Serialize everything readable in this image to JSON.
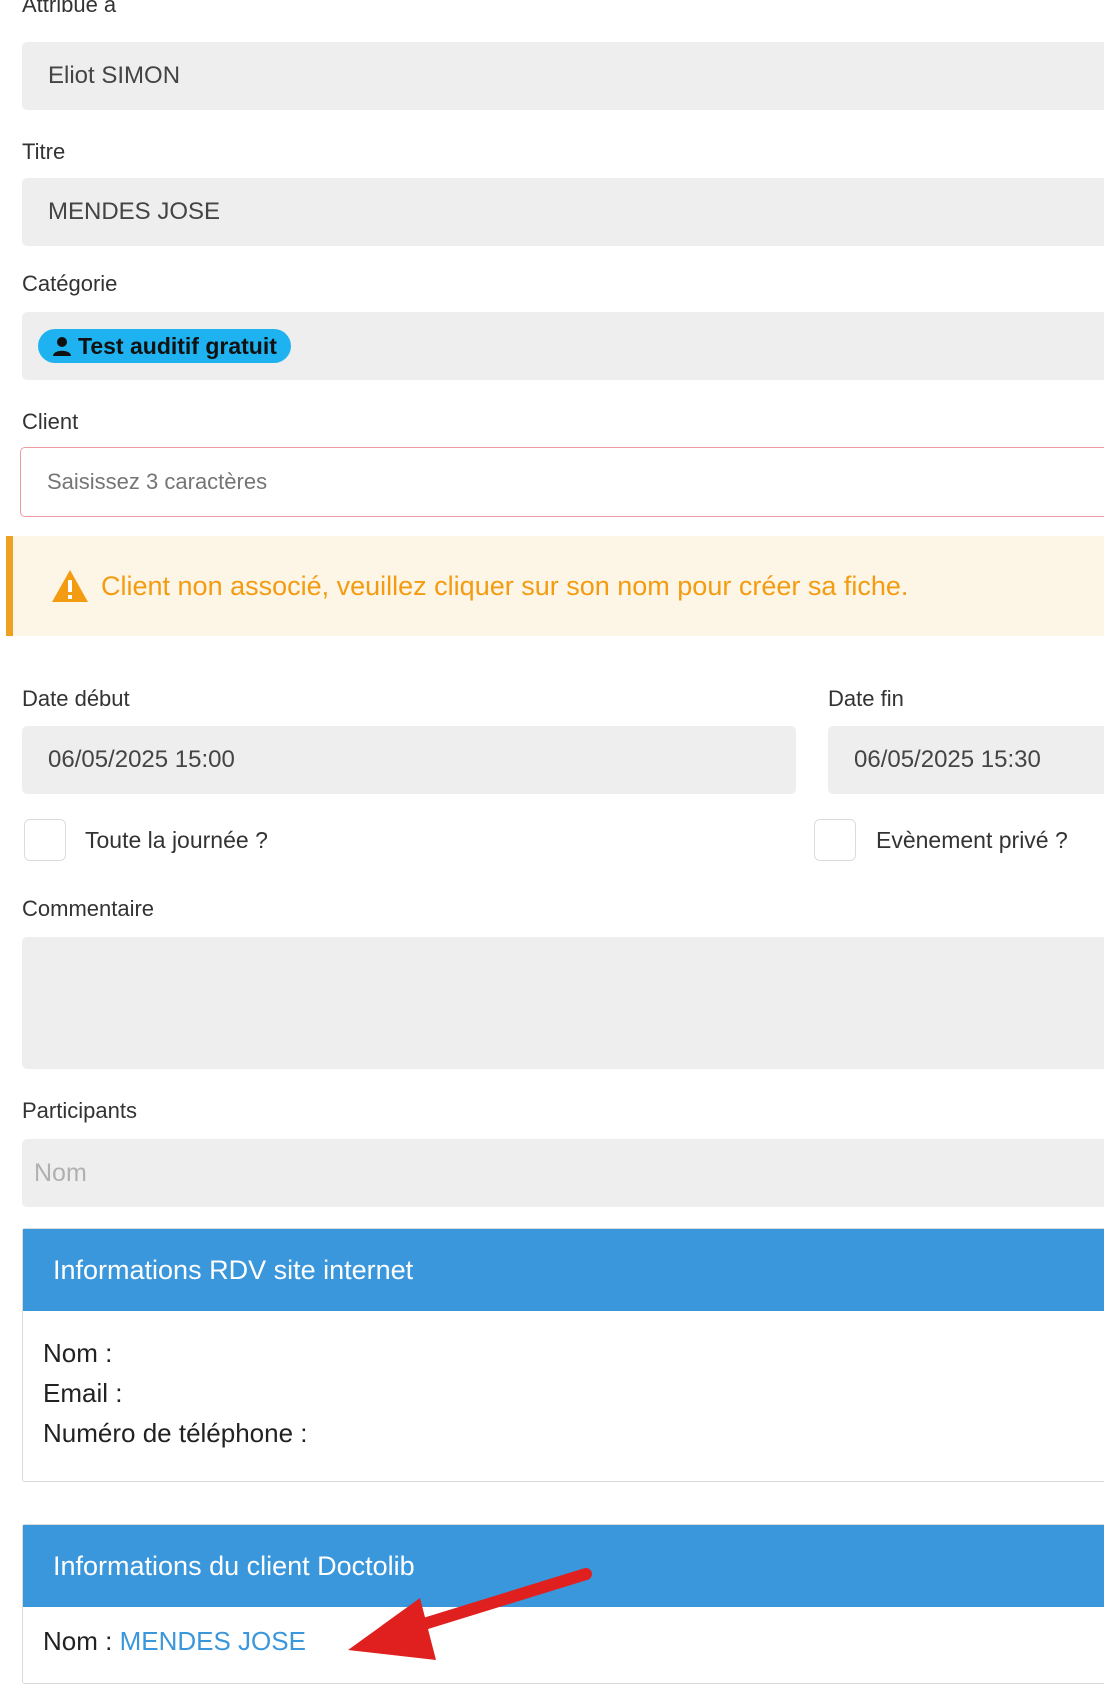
{
  "fields": {
    "assignee_label": "Attribué à",
    "assignee_value": "Eliot SIMON",
    "title_label": "Titre",
    "title_value": "MENDES JOSE",
    "category_label": "Catégorie",
    "category_badge": "Test auditif gratuit",
    "category_badge_color": "#1eb3f0",
    "client_label": "Client",
    "client_placeholder": "Saisissez 3 caractères"
  },
  "alert": {
    "text": "Client non associé, veuillez cliquer sur son nom pour créer sa fiche.",
    "color": "#f39c12"
  },
  "dates": {
    "start_label": "Date début",
    "start_value": "06/05/2025 15:00",
    "end_label": "Date fin",
    "end_value": "06/05/2025 15:30"
  },
  "options": {
    "all_day_label": "Toute la journée ?",
    "private_label": "Evènement privé ?"
  },
  "comment": {
    "label": "Commentaire",
    "value": ""
  },
  "participants": {
    "label": "Participants",
    "placeholder": "Nom"
  },
  "website_panel": {
    "title": "Informations RDV site internet",
    "name_label": "Nom :",
    "email_label": "Email :",
    "phone_label": "Numéro de téléphone :"
  },
  "doctolib_panel": {
    "title": "Informations du client Doctolib",
    "name_label": "Nom :",
    "name_link": "MENDES JOSE"
  },
  "colors": {
    "panel_header": "#3a97db",
    "annotation_arrow": "#e0201f"
  }
}
